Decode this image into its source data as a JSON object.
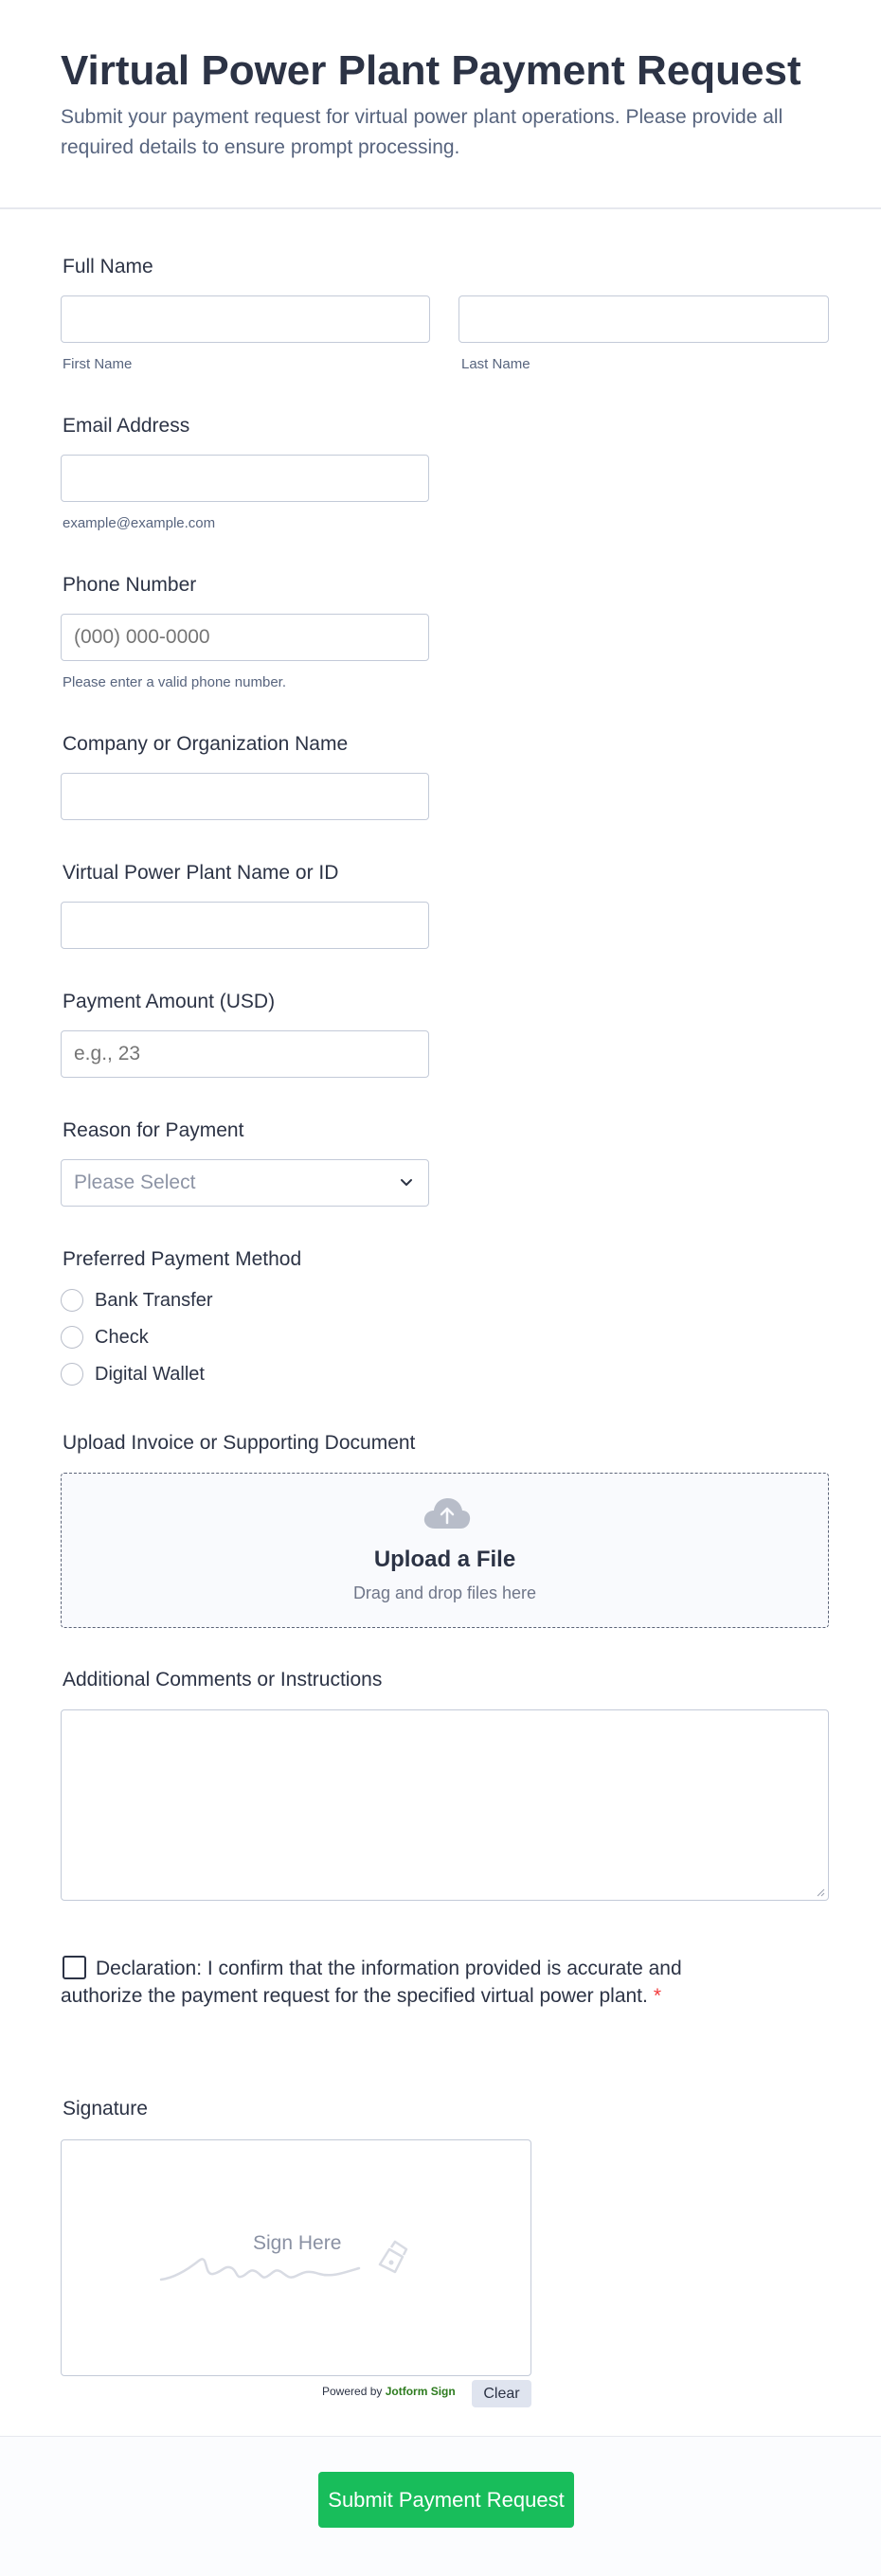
{
  "header": {
    "title": "Virtual Power Plant Payment Request",
    "subtitle": "Submit your payment request for virtual power plant operations. Please provide all required details to ensure prompt processing."
  },
  "full_name": {
    "label": "Full Name",
    "first_sublabel": "First Name",
    "last_sublabel": "Last Name",
    "first_value": "",
    "last_value": ""
  },
  "email": {
    "label": "Email Address",
    "sublabel": "example@example.com",
    "value": ""
  },
  "phone": {
    "label": "Phone Number",
    "placeholder": "(000) 000-0000",
    "sublabel": "Please enter a valid phone number."
  },
  "company": {
    "label": "Company or Organization Name",
    "value": ""
  },
  "vpp": {
    "label": "Virtual Power Plant Name or ID",
    "value": ""
  },
  "amount": {
    "label": "Payment Amount (USD)",
    "placeholder": "e.g., 23"
  },
  "reason": {
    "label": "Reason for Payment",
    "selected": "Please Select"
  },
  "method": {
    "label": "Preferred Payment Method",
    "options": [
      "Bank Transfer",
      "Check",
      "Digital Wallet"
    ]
  },
  "upload": {
    "label": "Upload Invoice or Supporting Document",
    "title": "Upload a File",
    "subtitle": "Drag and drop files here"
  },
  "comments": {
    "label": "Additional Comments or Instructions",
    "value": ""
  },
  "declaration": {
    "text": "Declaration: I confirm that the information provided is accurate and authorize the payment request for the specified virtual power plant.",
    "required_mark": "*"
  },
  "signature": {
    "label": "Signature",
    "placeholder": "Sign Here",
    "powered_by": "Powered by",
    "brand": "Jotform Sign",
    "clear_label": "Clear"
  },
  "submit": {
    "label": "Submit Payment Request"
  },
  "colors": {
    "accent": "#18bd5b",
    "text": "#2c3345",
    "required": "#f23a3c",
    "brand": "#2d7b1e"
  },
  "icons": [
    "upload-cloud-icon",
    "chevron-down-icon",
    "pen-icon",
    "resize-grip-icon"
  ]
}
